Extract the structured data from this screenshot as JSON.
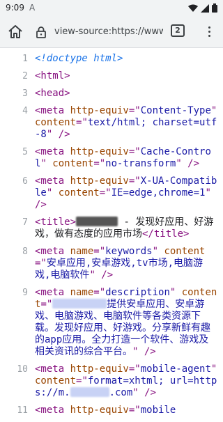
{
  "status_bar": {
    "time": "9:09",
    "app_indicator": "A"
  },
  "toolbar": {
    "url": "view-source:https://www.c",
    "tab_count": "2"
  },
  "source_lines": [
    {
      "num": "1",
      "parts": [
        {
          "t": "<!doctype html>",
          "c": "c-doctype"
        }
      ]
    },
    {
      "num": "2",
      "parts": [
        {
          "t": "<html>",
          "c": "c-tag"
        }
      ]
    },
    {
      "num": "3",
      "parts": [
        {
          "t": "<head>",
          "c": "c-tag"
        }
      ]
    },
    {
      "num": "4",
      "parts": [
        {
          "t": "<meta ",
          "c": "c-tag"
        },
        {
          "t": "http-equiv",
          "c": "c-attr"
        },
        {
          "t": "=\"",
          "c": "c-tag"
        },
        {
          "t": "Content-Type",
          "c": "c-val"
        },
        {
          "t": "\" ",
          "c": "c-tag"
        },
        {
          "t": "content",
          "c": "c-attr"
        },
        {
          "t": "=\"",
          "c": "c-tag"
        },
        {
          "t": "text/html; charset=utf-8",
          "c": "c-val"
        },
        {
          "t": "\" />",
          "c": "c-tag"
        }
      ]
    },
    {
      "num": "5",
      "parts": [
        {
          "t": "<meta ",
          "c": "c-tag"
        },
        {
          "t": "http-equiv",
          "c": "c-attr"
        },
        {
          "t": "=\"",
          "c": "c-tag"
        },
        {
          "t": "Cache-Control",
          "c": "c-val"
        },
        {
          "t": "\" ",
          "c": "c-tag"
        },
        {
          "t": "content",
          "c": "c-attr"
        },
        {
          "t": "=\"",
          "c": "c-tag"
        },
        {
          "t": "no-transform",
          "c": "c-val"
        },
        {
          "t": "\" />",
          "c": "c-tag"
        }
      ]
    },
    {
      "num": "6",
      "parts": [
        {
          "t": "<meta ",
          "c": "c-tag"
        },
        {
          "t": "http-equiv",
          "c": "c-attr"
        },
        {
          "t": "=\"",
          "c": "c-tag"
        },
        {
          "t": "X-UA-Compatible",
          "c": "c-val"
        },
        {
          "t": "\" ",
          "c": "c-tag"
        },
        {
          "t": "content",
          "c": "c-attr"
        },
        {
          "t": "=\"",
          "c": "c-tag"
        },
        {
          "t": "IE=edge,chrome=1",
          "c": "c-val"
        },
        {
          "t": "\" />",
          "c": "c-tag"
        }
      ]
    },
    {
      "num": "7",
      "parts": [
        {
          "t": "<title>",
          "c": "c-tag"
        },
        {
          "t": "",
          "c": "blur dark",
          "w": 60
        },
        {
          "t": " - 发现好应用、好游戏，做有态度的应用市场",
          "c": "c-text"
        },
        {
          "t": "</title>",
          "c": "c-tag"
        }
      ]
    },
    {
      "num": "8",
      "parts": [
        {
          "t": "<meta ",
          "c": "c-tag"
        },
        {
          "t": "name",
          "c": "c-attr"
        },
        {
          "t": "=\"",
          "c": "c-tag"
        },
        {
          "t": "keywords",
          "c": "c-val"
        },
        {
          "t": "\" ",
          "c": "c-tag"
        },
        {
          "t": "content",
          "c": "c-attr"
        },
        {
          "t": "=\"",
          "c": "c-tag"
        },
        {
          "t": "安卓应用,安卓游戏,tv市场,电脑游戏,电脑软件",
          "c": "c-val"
        },
        {
          "t": "\" />",
          "c": "c-tag"
        }
      ]
    },
    {
      "num": "9",
      "parts": [
        {
          "t": "<meta ",
          "c": "c-tag"
        },
        {
          "t": "name",
          "c": "c-attr"
        },
        {
          "t": "=\"",
          "c": "c-tag"
        },
        {
          "t": "description",
          "c": "c-val"
        },
        {
          "t": "\" ",
          "c": "c-tag"
        },
        {
          "t": "content",
          "c": "c-attr"
        },
        {
          "t": "=\"",
          "c": "c-tag"
        },
        {
          "t": "",
          "c": "blur",
          "w": 78
        },
        {
          "t": "提供安卓应用、安卓游戏、电脑游戏、电脑软件等各类资源下载。发现好应用、好游戏。分享新鲜有趣的app应用。全力打造一个软件、游戏及相关资讯的综合平台。",
          "c": "c-val"
        },
        {
          "t": "\" />",
          "c": "c-tag"
        }
      ]
    },
    {
      "num": "10",
      "parts": [
        {
          "t": "<meta ",
          "c": "c-tag"
        },
        {
          "t": "http-equiv",
          "c": "c-attr"
        },
        {
          "t": "=\"",
          "c": "c-tag"
        },
        {
          "t": "mobile-agent",
          "c": "c-val"
        },
        {
          "t": "\" ",
          "c": "c-tag"
        },
        {
          "t": "content",
          "c": "c-attr"
        },
        {
          "t": "=\"",
          "c": "c-tag"
        },
        {
          "t": "format=xhtml; url=https://m.",
          "c": "c-val"
        },
        {
          "t": "",
          "c": "blur",
          "w": 56
        },
        {
          "t": ".com",
          "c": "c-val"
        },
        {
          "t": "\" />",
          "c": "c-tag"
        }
      ]
    },
    {
      "num": "11",
      "parts": [
        {
          "t": "<meta ",
          "c": "c-tag"
        },
        {
          "t": "http-equiv",
          "c": "c-attr"
        },
        {
          "t": "=\"",
          "c": "c-tag"
        },
        {
          "t": "mobile",
          "c": "c-val"
        }
      ]
    }
  ]
}
